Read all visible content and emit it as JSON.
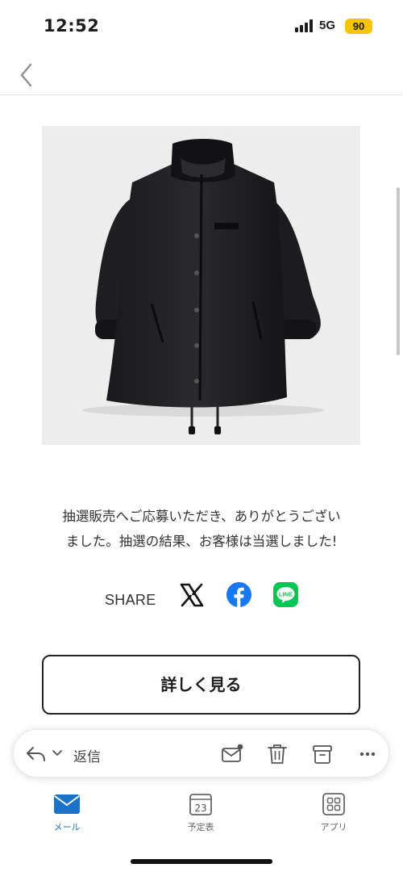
{
  "status_bar": {
    "time": "12:52",
    "network": "5G",
    "battery": "90",
    "battery_color": "#f4c500"
  },
  "nav": {
    "back_icon": "chevron-left-icon"
  },
  "product": {
    "image_desc_icon": "black-coat-image"
  },
  "message": {
    "line1": "抽選販売へご応募いただき、ありがとうござい",
    "line2": "ました。抽選の結果、お客様は当選しました!"
  },
  "share": {
    "label": "SHARE",
    "icons": [
      "x-logo-icon",
      "facebook-icon",
      "line-icon"
    ],
    "facebook_color": "#1877f2",
    "line_color": "#06c755"
  },
  "details_button": {
    "label": "詳しく見る"
  },
  "mail_toolbar": {
    "reply_label": "返信",
    "icons": [
      "reply-icon",
      "chevron-down-icon",
      "mark-unread-icon",
      "trash-icon",
      "archive-icon",
      "more-icon"
    ]
  },
  "tabs": [
    {
      "label": "メール",
      "icon": "mail-icon",
      "active": true
    },
    {
      "label": "予定表",
      "icon": "calendar-icon",
      "day": "23",
      "active": false
    },
    {
      "label": "アプリ",
      "icon": "apps-grid-icon",
      "active": false
    }
  ],
  "accent_color": "#1a73c8"
}
